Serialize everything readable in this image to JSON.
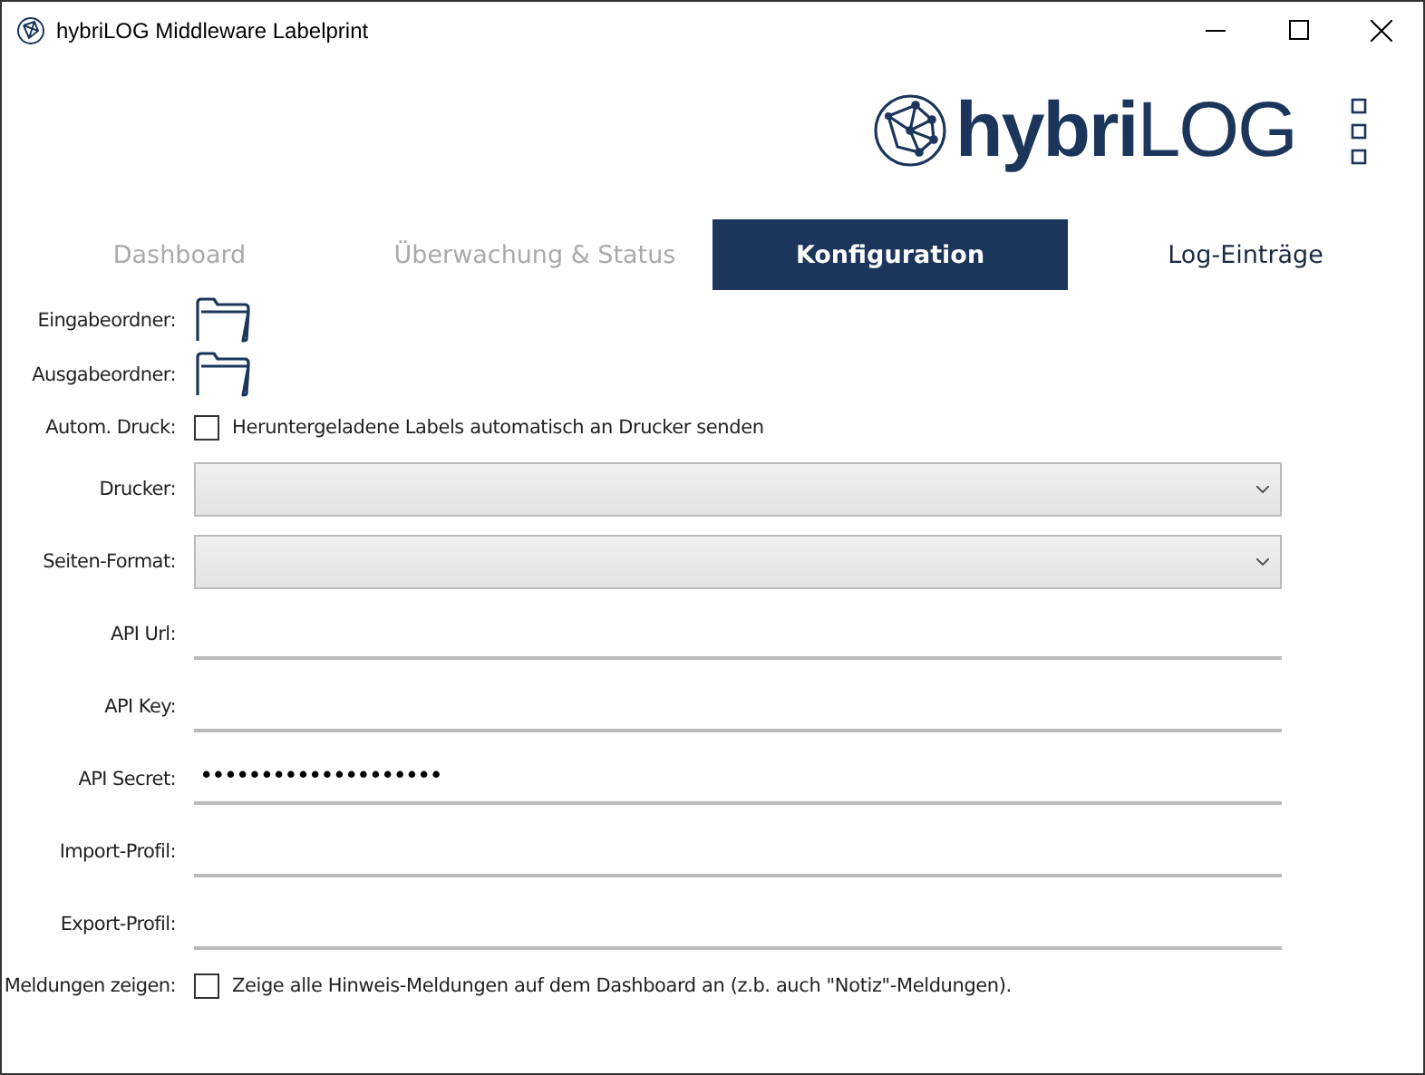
{
  "window": {
    "title": "hybriLOG Middleware Labelprint"
  },
  "logo": {
    "text": "**hybri**LOG"
  },
  "tabs": [
    {
      "label": "Dashboard",
      "selected": false
    },
    {
      "label": "Überwachung & Status",
      "selected": false
    },
    {
      "label": "Konfiguration",
      "selected": true
    },
    {
      "label": "Log-Einträge",
      "selected": false
    }
  ],
  "settings": [
    {
      "kind": "folder",
      "label": "Eingabeordner:"
    },
    {
      "kind": "folder",
      "label": "Ausgabeordner:"
    },
    {
      "kind": "checkbox",
      "label": "Autom. Druck:",
      "text": "Heruntergeladene Labels automatisch an Drucker senden",
      "checked": false
    },
    {
      "kind": "select",
      "label": "Drucker:"
    },
    {
      "kind": "select",
      "label": "Seiten-Format:"
    },
    {
      "kind": "text",
      "label": "API Url:"
    },
    {
      "kind": "text",
      "label": "API Key:"
    },
    {
      "kind": "text",
      "label": "API Secret:",
      "value": "••••••••••••••••••••"
    },
    {
      "kind": "text",
      "label": "Import-Profil:"
    },
    {
      "kind": "text",
      "label": "Export-Profil:"
    },
    {
      "kind": "checkbox",
      "label": "Meldungen zeigen:",
      "text": "Zeige alle Hinweis-Meldungen auf dem Dashboard an (z.b. auch \"Notiz\"-Meldungen).",
      "checked": false
    }
  ]
}
